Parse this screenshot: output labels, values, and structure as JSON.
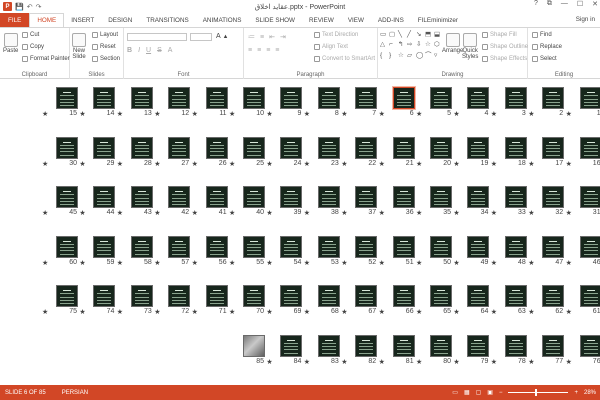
{
  "window": {
    "title": "عقاید اخلاق.pptx - PowerPoint",
    "controls": [
      "?",
      "⧉",
      "—",
      "☐",
      "✕"
    ]
  },
  "quick_access": {
    "app": "P",
    "save": "💾",
    "undo": "↶",
    "redo": "↷"
  },
  "tabs": [
    "FILE",
    "HOME",
    "INSERT",
    "DESIGN",
    "TRANSITIONS",
    "ANIMATIONS",
    "SLIDE SHOW",
    "REVIEW",
    "VIEW",
    "ADD-INS",
    "FILEminimizer"
  ],
  "active_tab": "HOME",
  "sign_in": "Sign in",
  "ribbon": {
    "clipboard": {
      "label": "Clipboard",
      "paste": "Paste",
      "cut": "Cut",
      "copy": "Copy",
      "format_painter": "Format Painter"
    },
    "slides": {
      "label": "Slides",
      "new_slide": "New",
      "new_slide_2": "Slide",
      "layout": "Layout",
      "reset": "Reset",
      "section": "Section"
    },
    "font": {
      "label": "Font"
    },
    "paragraph": {
      "label": "Paragraph",
      "text_direction": "Text Direction",
      "align_text": "Align Text",
      "convert_smartart": "Convert to SmartArt"
    },
    "drawing": {
      "label": "Drawing",
      "arrange": "Arrange",
      "quick_styles": "Quick",
      "quick_styles_2": "Styles",
      "shape_fill": "Shape Fill",
      "shape_outline": "Shape Outline",
      "shape_effects": "Shape Effects"
    },
    "editing": {
      "label": "Editing",
      "find": "Find",
      "replace": "Replace",
      "select": "Select"
    }
  },
  "slides": {
    "rows": [
      [
        15,
        14,
        13,
        12,
        11,
        10,
        9,
        8,
        7,
        6,
        5,
        4,
        3,
        2,
        1
      ],
      [
        30,
        29,
        28,
        27,
        26,
        25,
        24,
        23,
        22,
        21,
        20,
        19,
        18,
        17,
        16
      ],
      [
        45,
        44,
        43,
        42,
        41,
        40,
        39,
        38,
        37,
        36,
        35,
        34,
        33,
        32,
        31
      ],
      [
        60,
        59,
        58,
        57,
        56,
        55,
        54,
        53,
        52,
        51,
        50,
        49,
        48,
        47,
        46
      ],
      [
        75,
        74,
        73,
        72,
        71,
        70,
        69,
        68,
        67,
        66,
        65,
        64,
        63,
        62,
        61
      ],
      [
        85,
        84,
        83,
        82,
        81,
        80,
        79,
        78,
        77,
        76
      ]
    ],
    "selected": 6,
    "photo_slide": 85,
    "transition_marker": "★"
  },
  "status": {
    "slide_info": "SLIDE 6 OF 85",
    "language": "PERSIAN",
    "zoom": "28%",
    "zoom_fraction": 0.28
  }
}
